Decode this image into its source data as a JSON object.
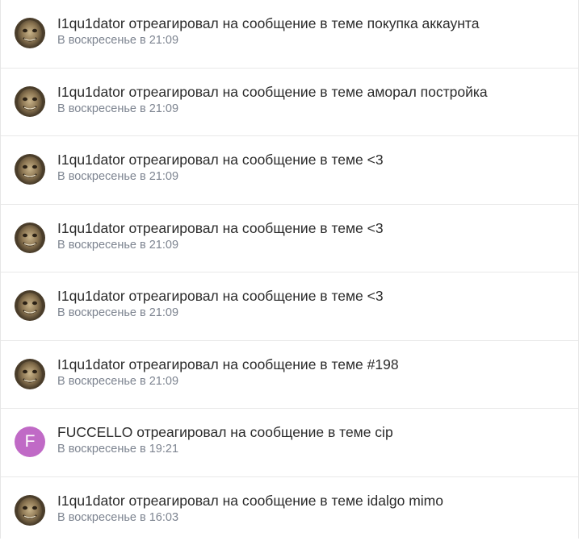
{
  "notifications": [
    {
      "avatar_type": "photo",
      "text": "I1qu1dator отреагировал на сообщение в теме покупка аккаунта",
      "time": "В воскресенье в 21:09"
    },
    {
      "avatar_type": "photo",
      "text": "I1qu1dator отреагировал на сообщение в теме аморал постройка",
      "time": "В воскресенье в 21:09"
    },
    {
      "avatar_type": "photo",
      "text": "I1qu1dator отреагировал на сообщение в теме <3",
      "time": "В воскресенье в 21:09"
    },
    {
      "avatar_type": "photo",
      "text": "I1qu1dator отреагировал на сообщение в теме <3",
      "time": "В воскресенье в 21:09"
    },
    {
      "avatar_type": "photo",
      "text": "I1qu1dator отреагировал на сообщение в теме <3",
      "time": "В воскресенье в 21:09"
    },
    {
      "avatar_type": "photo",
      "text": "I1qu1dator отреагировал на сообщение в теме #198",
      "time": "В воскресенье в 21:09"
    },
    {
      "avatar_type": "letter",
      "avatar_letter": "F",
      "avatar_color": "#c06ac6",
      "text": "FUCCELLO отреагировал на сообщение в теме cip",
      "time": "В воскресенье в 19:21"
    },
    {
      "avatar_type": "photo",
      "text": "I1qu1dator отреагировал на сообщение в теме idalgo mimo",
      "time": "В воскресенье в 16:03"
    }
  ]
}
